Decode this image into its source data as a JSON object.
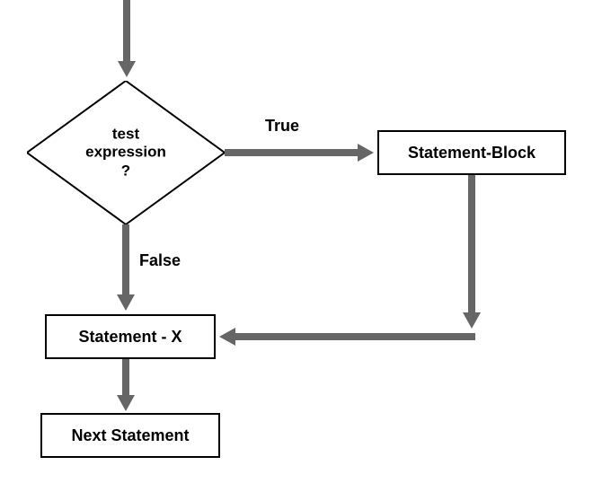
{
  "diagram": {
    "decision": {
      "line1": "test",
      "line2": "expression",
      "line3": "?"
    },
    "labels": {
      "true": "True",
      "false": "False"
    },
    "blocks": {
      "statement_block": "Statement-Block",
      "statement_x": "Statement - X",
      "next_statement": "Next Statement"
    }
  },
  "chart_data": {
    "type": "flowchart",
    "nodes": [
      {
        "id": "start",
        "type": "entry"
      },
      {
        "id": "decision",
        "type": "decision",
        "text": "test expression ?"
      },
      {
        "id": "stmt_block",
        "type": "process",
        "text": "Statement-Block"
      },
      {
        "id": "stmt_x",
        "type": "process",
        "text": "Statement - X"
      },
      {
        "id": "next",
        "type": "process",
        "text": "Next Statement"
      }
    ],
    "edges": [
      {
        "from": "start",
        "to": "decision"
      },
      {
        "from": "decision",
        "to": "stmt_block",
        "label": "True"
      },
      {
        "from": "decision",
        "to": "stmt_x",
        "label": "False"
      },
      {
        "from": "stmt_block",
        "to": "stmt_x"
      },
      {
        "from": "stmt_x",
        "to": "next"
      }
    ]
  }
}
